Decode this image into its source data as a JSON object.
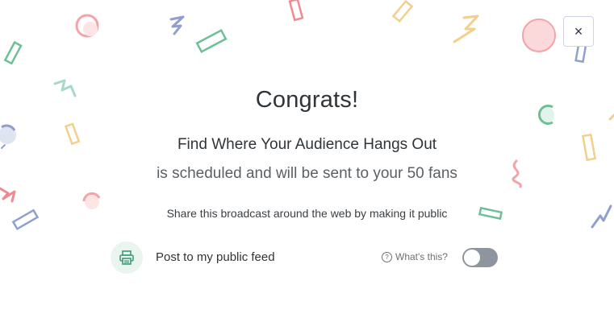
{
  "modal": {
    "close_symbol": "×",
    "title": "Congrats!",
    "broadcast_name": "Find Where Your Audience Hangs Out",
    "scheduled_text": "is scheduled and will be sent to your 50 fans",
    "share_text": "Share this broadcast around the web by making it public"
  },
  "feed": {
    "icon": "printer-icon",
    "label": "Post to my public feed",
    "help_symbol": "?",
    "whats_this": "What's this?",
    "toggle_on": false
  },
  "colors": {
    "confetti": [
      "#f4a3a8",
      "#8fa0d0",
      "#6fbf96",
      "#f3cf8a",
      "#a9d9c4"
    ],
    "toggle_off": "#8f959e",
    "icon_bg": "#eaf5f0",
    "icon_fg": "#3f9d77"
  }
}
